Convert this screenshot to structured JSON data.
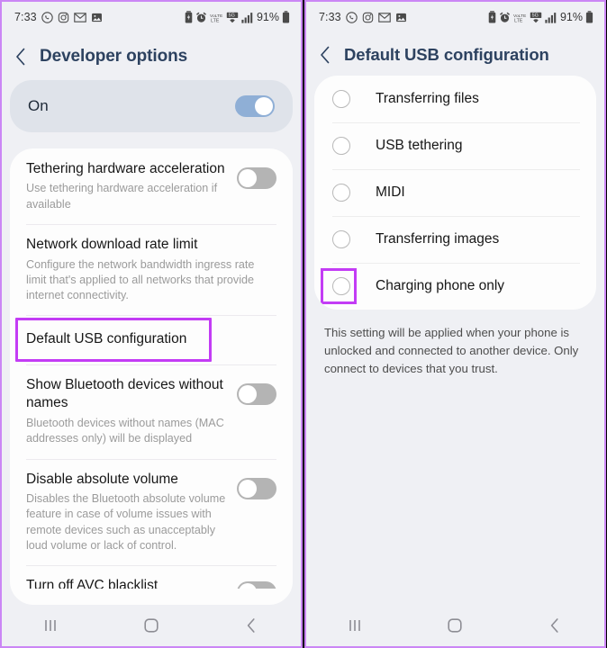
{
  "left_phone": {
    "status_bar": {
      "time": "7:33",
      "app_icons": [
        "whatsapp-icon",
        "instagram-icon",
        "gmail-icon",
        "gallery-icon"
      ],
      "system_icons": [
        "battery-saver-icon",
        "alarm-icon",
        "volte-icon",
        "5g-icon",
        "signal-bars-icon"
      ],
      "battery_percent": "91%"
    },
    "header": {
      "back_icon": "back-chevron-icon",
      "title": "Developer options"
    },
    "master_switch": {
      "label": "On",
      "state": "on"
    },
    "settings": [
      {
        "title": "Tethering hardware acceleration",
        "subtitle": "Use tethering hardware acceleration if available",
        "toggle": "off"
      },
      {
        "title": "Network download rate limit",
        "subtitle": "Configure the network bandwidth ingress rate limit that's applied to all networks that provide internet connectivity.",
        "toggle": null
      },
      {
        "title": "Default USB configuration",
        "subtitle": "",
        "toggle": null,
        "highlighted": true
      },
      {
        "title": "Show Bluetooth devices without names",
        "subtitle": "Bluetooth devices without names (MAC addresses only) will be displayed",
        "toggle": "off"
      },
      {
        "title": "Disable absolute volume",
        "subtitle": "Disables the Bluetooth absolute volume feature in case of volume issues with remote devices such as unacceptably loud volume or lack of control.",
        "toggle": "off"
      },
      {
        "title": "Turn off AVC blacklist",
        "subtitle": "",
        "toggle": "off",
        "clipped": true
      }
    ],
    "nav_bar": [
      "recents-icon",
      "home-icon",
      "back-icon"
    ]
  },
  "right_phone": {
    "status_bar": {
      "time": "7:33",
      "battery_percent": "91%"
    },
    "header": {
      "back_icon": "back-chevron-icon",
      "title": "Default USB configuration"
    },
    "options": [
      {
        "label": "Transferring files",
        "selected": false
      },
      {
        "label": "USB tethering",
        "selected": false
      },
      {
        "label": "MIDI",
        "selected": false
      },
      {
        "label": "Transferring images",
        "selected": false
      },
      {
        "label": "Charging phone only",
        "selected": false,
        "highlighted": true
      }
    ],
    "footer_note": "This setting will be applied when your phone is unlocked and connected to another device. Only connect to devices that you trust.",
    "nav_bar": [
      "recents-icon",
      "home-icon",
      "back-icon"
    ]
  },
  "colors": {
    "highlight_purple": "#c33cf5",
    "frame_purple": "#cb86f5",
    "header_navy": "#2d4260",
    "toggle_on_blue": "#8fafd6",
    "page_bg": "#eff0f4"
  }
}
